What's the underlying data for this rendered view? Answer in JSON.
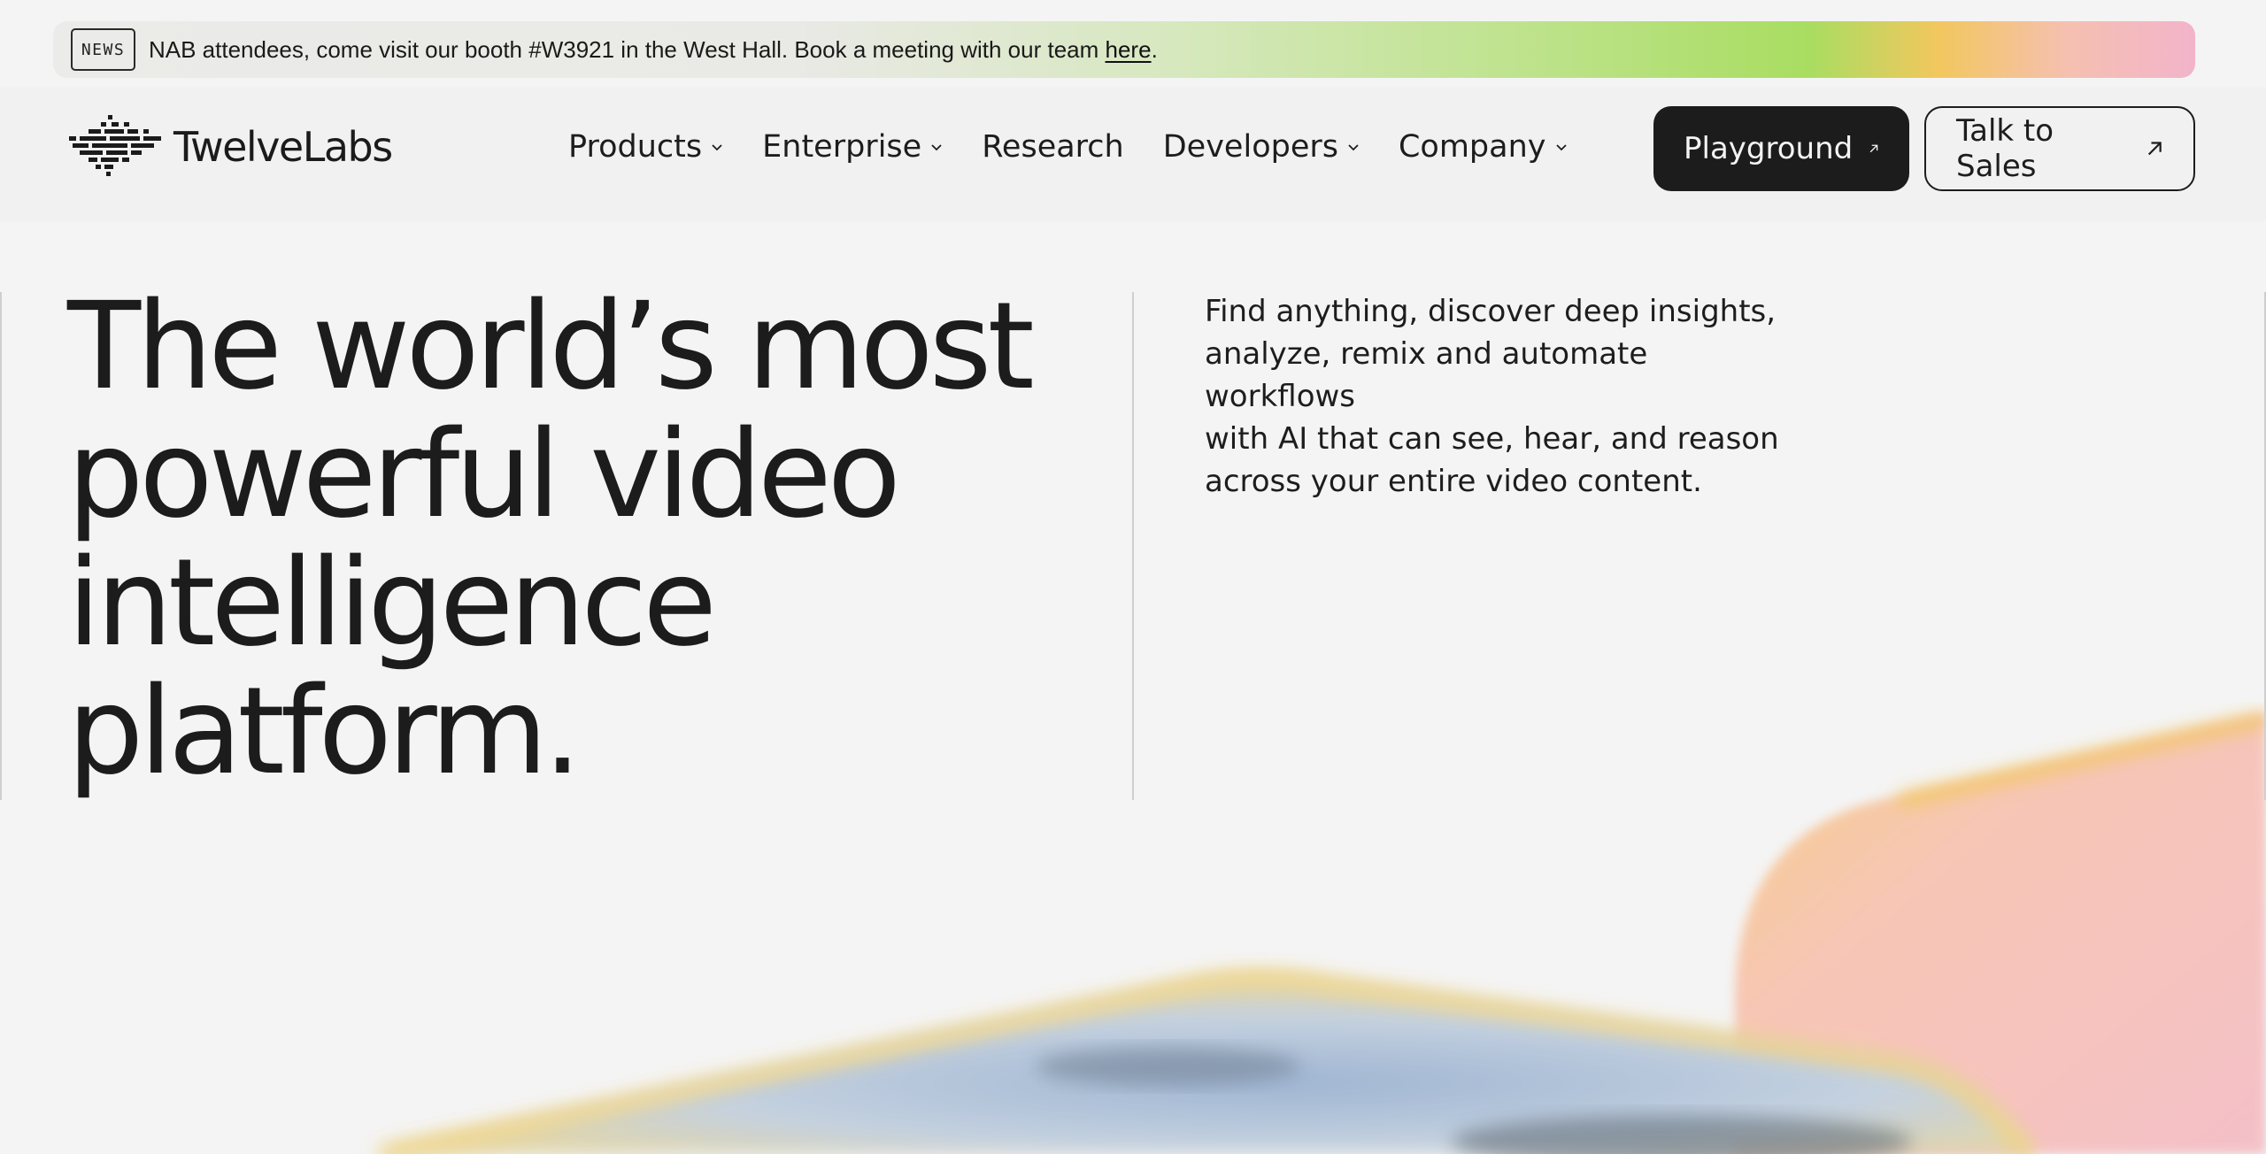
{
  "announcement": {
    "badge": "NEWS",
    "text": "NAB attendees, come visit our booth #W3921 in the West Hall. Book a meeting with our team ",
    "link_text": "here",
    "suffix": "."
  },
  "brand": {
    "name": "TwelveLabs",
    "logo_icon": "twelvelabs-logo-mark"
  },
  "nav": {
    "items": [
      {
        "label": "Products",
        "has_dropdown": true
      },
      {
        "label": "Enterprise",
        "has_dropdown": true
      },
      {
        "label": "Research",
        "has_dropdown": false
      },
      {
        "label": "Developers",
        "has_dropdown": true
      },
      {
        "label": "Company",
        "has_dropdown": true
      }
    ]
  },
  "actions": {
    "playground_label": "Playground",
    "sales_label": "Talk to Sales",
    "arrow_icon": "arrow-up-right-icon"
  },
  "hero": {
    "title_lines": [
      "The world’s most",
      "powerful video",
      "intelligence",
      "platform."
    ],
    "subtitle_lines": [
      "Find anything, discover deep insights,",
      "analyze, remix and automate workflows",
      "with AI that can see, hear, and reason",
      "across your entire video content."
    ]
  },
  "colors": {
    "primary_button": "#1c1c1c",
    "page_background": "#f4f4f4",
    "accent_green": "#a9dd61",
    "accent_yellow": "#f2c75e",
    "accent_pink": "#f2b4cb"
  }
}
